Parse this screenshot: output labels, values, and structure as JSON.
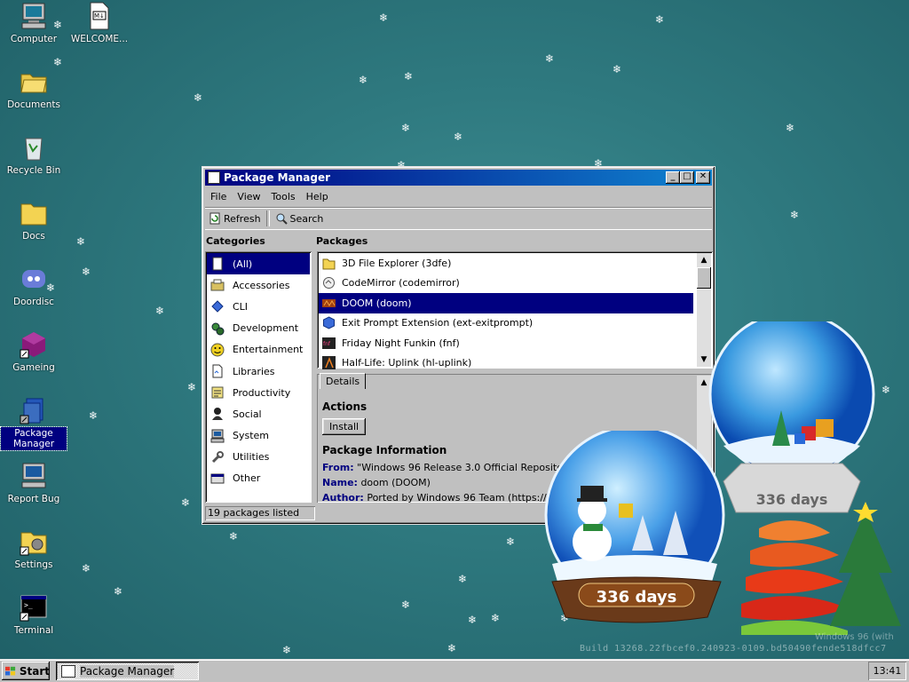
{
  "desktop": {
    "icons": [
      {
        "label": "Computer"
      },
      {
        "label": "WELCOME..."
      },
      {
        "label": "Documents"
      },
      {
        "label": "Recycle Bin"
      },
      {
        "label": "Docs"
      },
      {
        "label": "Doordisc"
      },
      {
        "label": "Gameing"
      },
      {
        "label": "Package Manager"
      },
      {
        "label": "Report Bug"
      },
      {
        "label": "Settings"
      },
      {
        "label": "Terminal"
      }
    ],
    "build_text": "Build 13268.22fbcef0.240923-0109.bd50490fende518dfcc7",
    "windows_text": "Windows 96 (with",
    "globe_left_text": "336 days",
    "globe_right_text": "336 days"
  },
  "window": {
    "title": "Package Manager",
    "menu": [
      "File",
      "View",
      "Tools",
      "Help"
    ],
    "toolbar": {
      "refresh": "Refresh",
      "search": "Search"
    },
    "categories_header": "Categories",
    "packages_header": "Packages",
    "categories": [
      {
        "label": "(All)",
        "icon": "all-icon",
        "selected": true
      },
      {
        "label": "Accessories",
        "icon": "accessories-icon"
      },
      {
        "label": "CLI",
        "icon": "cli-icon"
      },
      {
        "label": "Development",
        "icon": "development-icon"
      },
      {
        "label": "Entertainment",
        "icon": "entertainment-icon"
      },
      {
        "label": "Libraries",
        "icon": "libraries-icon"
      },
      {
        "label": "Productivity",
        "icon": "productivity-icon"
      },
      {
        "label": "Social",
        "icon": "social-icon"
      },
      {
        "label": "System",
        "icon": "system-icon"
      },
      {
        "label": "Utilities",
        "icon": "utilities-icon"
      },
      {
        "label": "Other",
        "icon": "other-icon"
      }
    ],
    "packages": [
      {
        "label": "3D File Explorer (3dfe)",
        "icon": "folder-icon"
      },
      {
        "label": "CodeMirror (codemirror)",
        "icon": "codemirror-icon"
      },
      {
        "label": "DOOM (doom)",
        "icon": "doom-icon",
        "selected": true
      },
      {
        "label": "Exit Prompt Extension (ext-exitprompt)",
        "icon": "cube-icon"
      },
      {
        "label": "Friday Night Funkin (fnf)",
        "icon": "fnf-icon"
      },
      {
        "label": "Half-Life: Uplink (hl-uplink)",
        "icon": "halflife-icon"
      }
    ],
    "details": {
      "tab": "Details",
      "actions_header": "Actions",
      "install_label": "Install",
      "info_header": "Package Information",
      "from_key": "From:",
      "from_val": "\"Windows 96 Release 3.0 Official Repository\"",
      "name_key": "Name:",
      "name_val": "doom (DOOM)",
      "author_key": "Author:",
      "author_val": "Ported by Windows 96 Team (https://windows96.net)"
    },
    "status": "19 packages listed"
  },
  "taskbar": {
    "start": "Start",
    "active_task": "Package Manager",
    "clock": "13:41"
  }
}
